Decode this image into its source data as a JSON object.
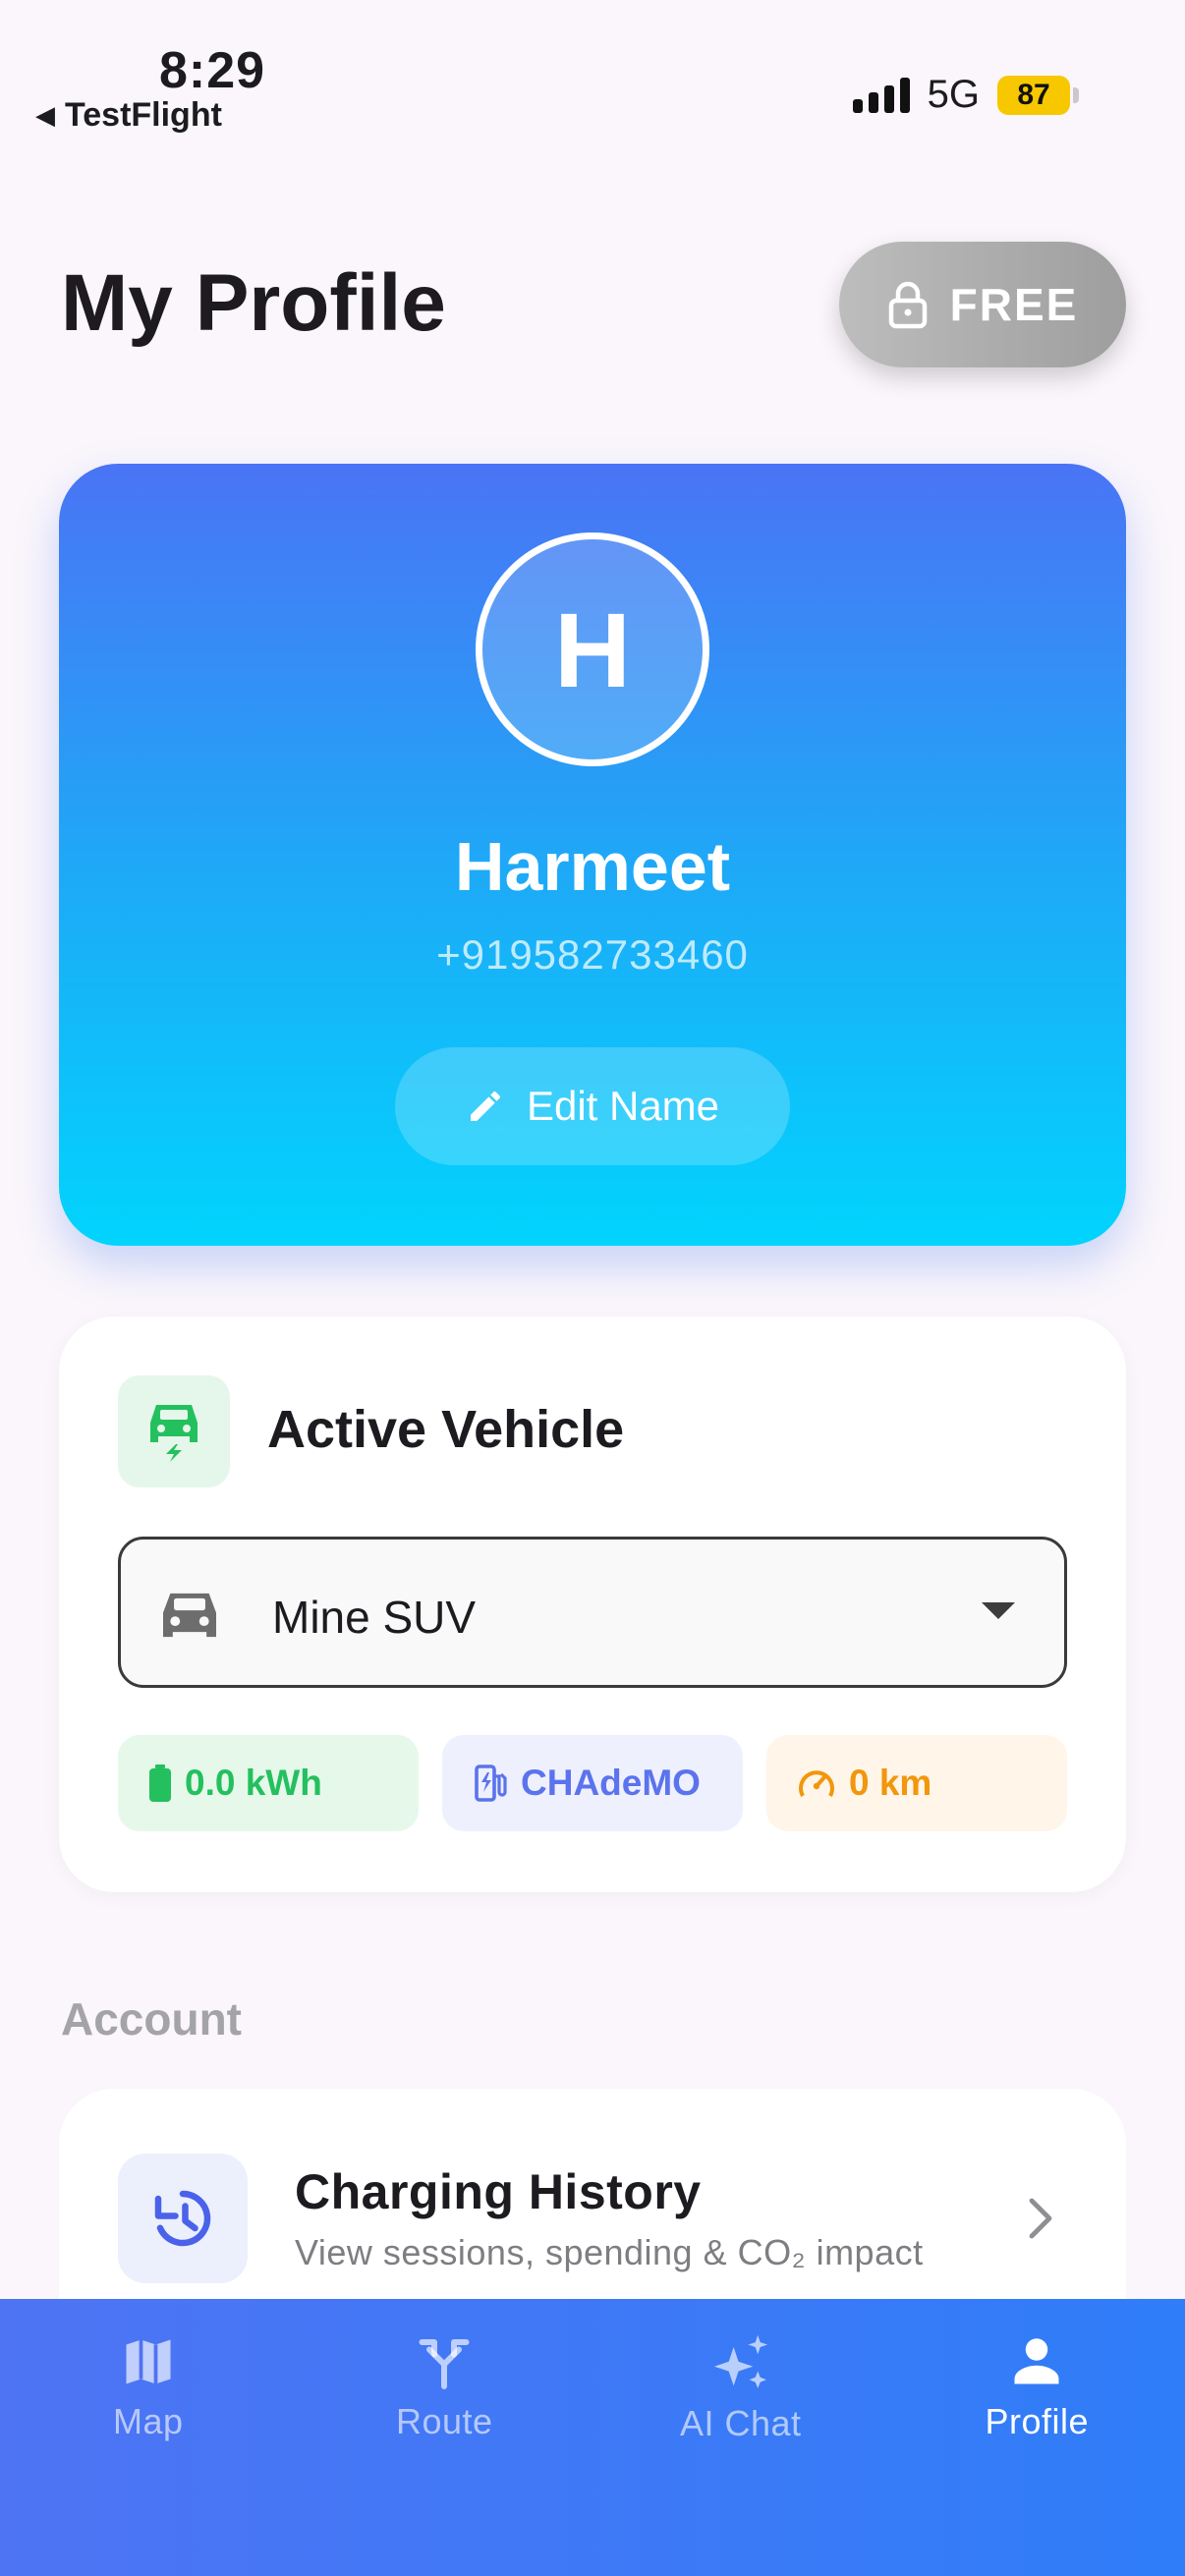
{
  "status_bar": {
    "time": "8:29",
    "back_app": "TestFlight",
    "network": "5G",
    "battery": "87"
  },
  "header": {
    "title": "My Profile",
    "plan_badge": "FREE"
  },
  "profile": {
    "initial": "H",
    "name": "Harmeet",
    "phone": "+919582733460",
    "edit_label": "Edit Name"
  },
  "vehicle": {
    "title": "Active Vehicle",
    "selected": "Mine SUV",
    "battery_capacity": "0.0 kWh",
    "connector": "CHAdeMO",
    "range": "0 km"
  },
  "account": {
    "section_label": "Account",
    "items": [
      {
        "title": "Charging History",
        "subtitle": "View sessions, spending & CO₂ impact"
      }
    ]
  },
  "tabs": [
    {
      "label": "Map",
      "icon": "map-icon"
    },
    {
      "label": "Route",
      "icon": "route-icon"
    },
    {
      "label": "AI Chat",
      "icon": "sparkles-icon"
    },
    {
      "label": "Profile",
      "icon": "person-icon",
      "active": true
    }
  ],
  "colors": {
    "card_gradient_top": "#4a74f5",
    "card_gradient_bottom": "#01d4fd",
    "tab_bar": "#3a7af6",
    "green": "#24c05e",
    "blue": "#5b73ec",
    "orange": "#f2960c"
  }
}
